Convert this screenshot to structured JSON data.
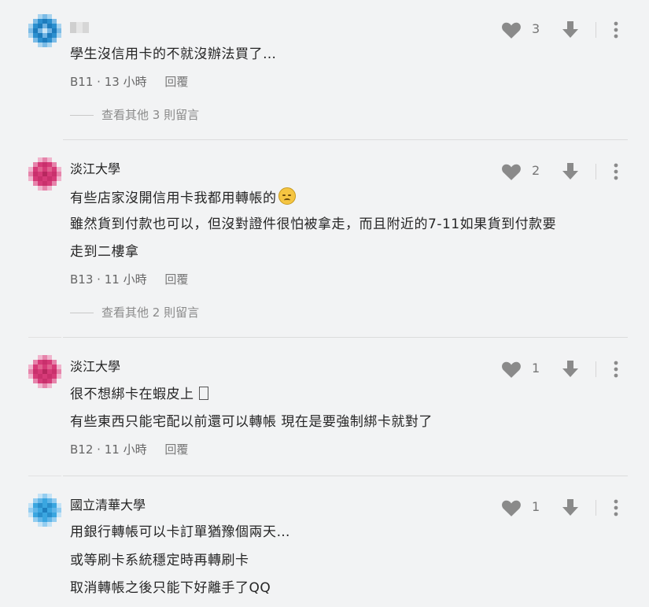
{
  "comments": [
    {
      "school": "",
      "avatar_color": "#2b8fcf",
      "lines": [
        "學生沒信用卡的不就沒辦法買了…"
      ],
      "floor": "B11",
      "time": "13 小時",
      "reply_label": "回覆",
      "likes": "3",
      "more_replies": "查看其他 3 則留言"
    },
    {
      "school": "淡江大學",
      "avatar_color": "#d63a78",
      "lines": [
        "有些店家沒開信用卡我都用轉帳的",
        "雖然貨到付款也可以，但沒對證件很怕被拿走，而且附近的7-11如果貨到付款要",
        "走到二樓拿"
      ],
      "emoji": "disappointed-face-emoji",
      "floor": "B13",
      "time": "11 小時",
      "reply_label": "回覆",
      "likes": "2",
      "more_replies": "查看其他 2 則留言"
    },
    {
      "school": "淡江大學",
      "avatar_color": "#d63a78",
      "lines": [
        "很不想綁卡在蝦皮上",
        "有些東西只能宅配以前還可以轉帳 現在是要強制綁卡就對了"
      ],
      "floor": "B12",
      "time": "11 小時",
      "reply_label": "回覆",
      "likes": "1"
    },
    {
      "school": "國立清華大學",
      "avatar_color": "#3aa6e0",
      "lines": [
        "用銀行轉帳可以卡訂單猶豫個兩天…",
        "或等刷卡系統穩定時再轉刷卡",
        "取消轉帳之後只能下好離手了QQ"
      ],
      "likes": "1"
    }
  ],
  "separator": "·",
  "icons": {
    "like": "heart-icon",
    "dislike": "arrow-down-icon",
    "menu": "more-vertical-icon"
  },
  "colors": {
    "background": "#f2f3f4",
    "icon": "#8a8a8a",
    "meta_text": "#666666"
  }
}
